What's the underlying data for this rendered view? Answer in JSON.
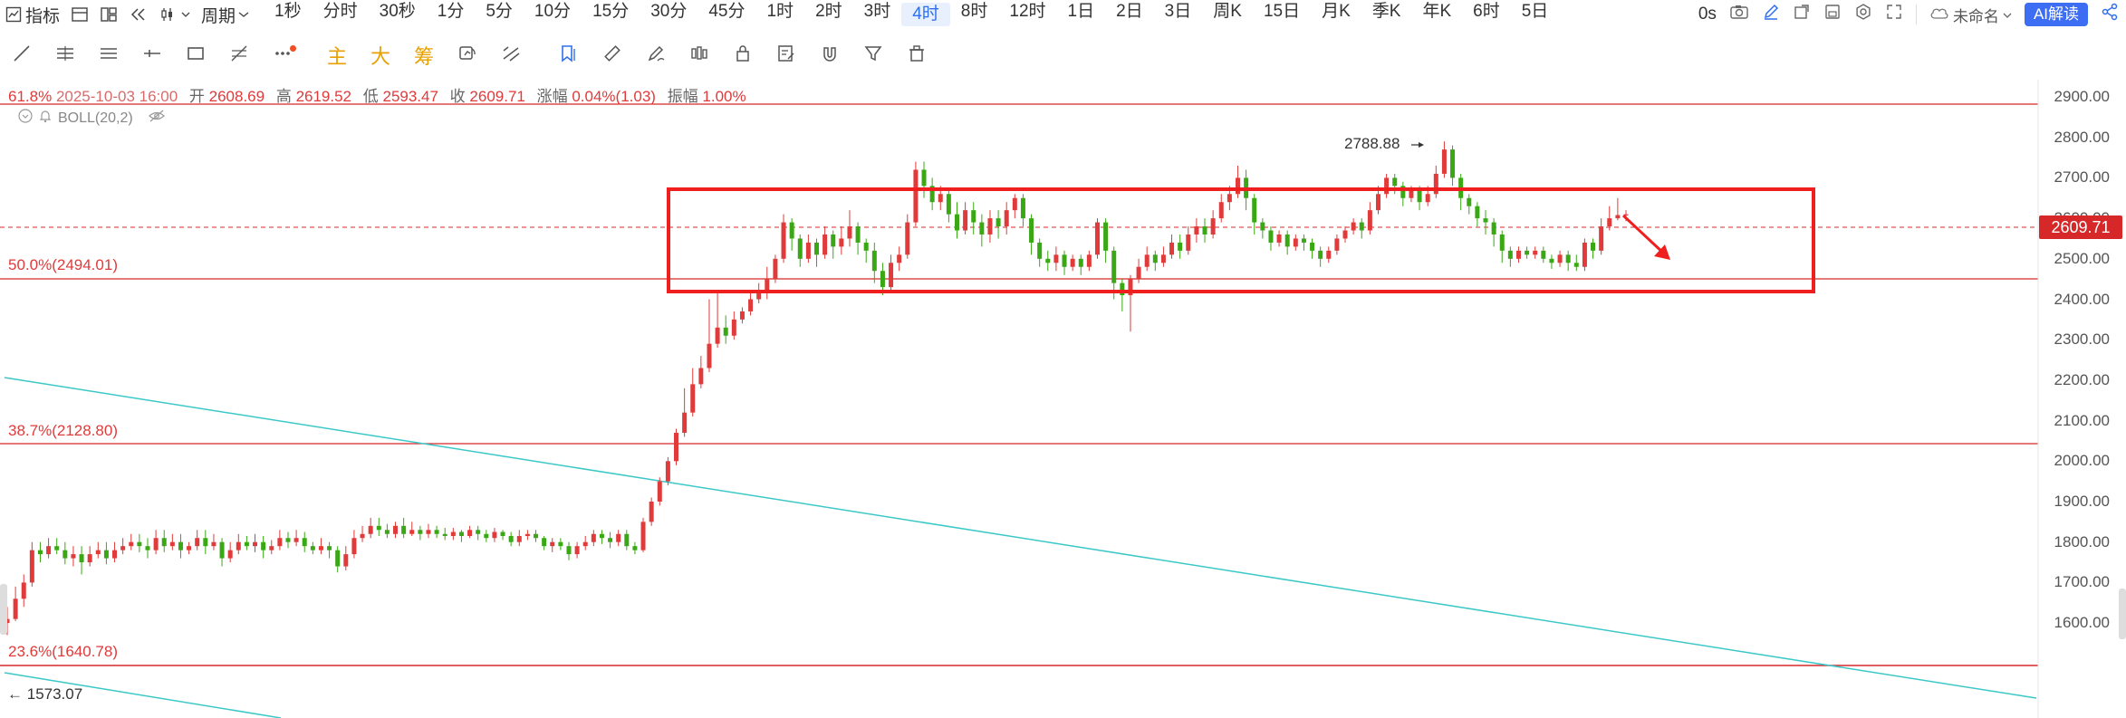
{
  "toolbar": {
    "indicator_label": "指标",
    "period_label": "周期",
    "timeframes": [
      "1秒",
      "分时",
      "30秒",
      "1分",
      "5分",
      "10分",
      "15分",
      "30分",
      "45分",
      "1时",
      "2时",
      "3时",
      "4时",
      "8时",
      "12时",
      "1日",
      "2日",
      "3日",
      "周K",
      "15日",
      "月K",
      "季K",
      "年K",
      "6时",
      "5日"
    ],
    "active_timeframe": "4时",
    "countdown": "0s",
    "unnamed_label": "未命名",
    "ai_button": "AI解读"
  },
  "drawing_toolbar": {
    "main_label": "主",
    "big_label": "大",
    "chip_label": "筹"
  },
  "ohlc_bar": {
    "fib_prefix": "61.8%",
    "date": "2025-10-03 16:00",
    "open_label": "开",
    "open": "2608.69",
    "high_label": "高",
    "high": "2619.52",
    "low_label": "低",
    "low": "2593.47",
    "close_label": "收",
    "close": "2609.71",
    "change_label": "涨幅",
    "change": "0.04%(1.03)",
    "amplitude_label": "振幅",
    "amplitude": "1.00%"
  },
  "indicator_row": {
    "boll_label": "BOLL(20,2)"
  },
  "fib_levels": [
    {
      "label": "50.0%(2494.01)",
      "price": 2494.01
    },
    {
      "label": "38.7%(2128.80)",
      "price": 2128.8
    },
    {
      "label": "23.6%(1640.78)",
      "price": 1640.78
    }
  ],
  "y_axis": [
    "2900.00",
    "2800.00",
    "2700.00",
    "2600.00",
    "2500.00",
    "2400.00",
    "2300.00",
    "2200.00",
    "2100.00",
    "2000.00",
    "1900.00",
    "1800.00",
    "1700.00",
    "1600.00"
  ],
  "current_price_tag": "2609.71",
  "annotations": {
    "high_marker": "2788.88",
    "low_marker": "1573.07"
  },
  "colors": {
    "up": "#e03a3a",
    "down": "#3aa815",
    "fib_line": "#d62828",
    "trend_line": "#3cc8c8",
    "accent": "#2f6fed",
    "box": "#f01f1f"
  },
  "chart_data": {
    "type": "candlestick",
    "ylim": [
      1560,
      2925
    ],
    "highest": 2788.88,
    "lowest": 1573.07,
    "last_close": 2609.71,
    "candles": [
      [
        1600,
        1610,
        1570,
        1640
      ],
      [
        1610,
        1660,
        1605,
        1690
      ],
      [
        1660,
        1700,
        1640,
        1720
      ],
      [
        1700,
        1780,
        1690,
        1800
      ],
      [
        1780,
        1770,
        1750,
        1800
      ],
      [
        1770,
        1790,
        1760,
        1810
      ],
      [
        1790,
        1780,
        1770,
        1810
      ],
      [
        1780,
        1760,
        1745,
        1800
      ],
      [
        1760,
        1770,
        1740,
        1790
      ],
      [
        1770,
        1750,
        1720,
        1790
      ],
      [
        1750,
        1770,
        1740,
        1790
      ],
      [
        1770,
        1780,
        1760,
        1800
      ],
      [
        1780,
        1760,
        1745,
        1800
      ],
      [
        1760,
        1780,
        1750,
        1800
      ],
      [
        1780,
        1790,
        1770,
        1810
      ],
      [
        1790,
        1800,
        1780,
        1820
      ],
      [
        1800,
        1790,
        1775,
        1820
      ],
      [
        1790,
        1780,
        1760,
        1810
      ],
      [
        1780,
        1810,
        1770,
        1830
      ],
      [
        1810,
        1790,
        1775,
        1830
      ],
      [
        1790,
        1800,
        1780,
        1820
      ],
      [
        1800,
        1780,
        1760,
        1820
      ],
      [
        1780,
        1790,
        1770,
        1800
      ],
      [
        1790,
        1810,
        1780,
        1830
      ],
      [
        1810,
        1790,
        1770,
        1830
      ],
      [
        1790,
        1800,
        1780,
        1820
      ],
      [
        1800,
        1760,
        1740,
        1810
      ],
      [
        1760,
        1780,
        1750,
        1800
      ],
      [
        1780,
        1800,
        1770,
        1820
      ],
      [
        1800,
        1790,
        1780,
        1815
      ],
      [
        1790,
        1800,
        1775,
        1820
      ],
      [
        1800,
        1780,
        1760,
        1815
      ],
      [
        1780,
        1790,
        1770,
        1805
      ],
      [
        1790,
        1810,
        1780,
        1830
      ],
      [
        1810,
        1800,
        1785,
        1825
      ],
      [
        1800,
        1810,
        1790,
        1830
      ],
      [
        1810,
        1790,
        1775,
        1825
      ],
      [
        1790,
        1780,
        1770,
        1800
      ],
      [
        1780,
        1790,
        1770,
        1810
      ],
      [
        1790,
        1780,
        1760,
        1800
      ],
      [
        1780,
        1740,
        1725,
        1790
      ],
      [
        1740,
        1770,
        1730,
        1790
      ],
      [
        1770,
        1810,
        1760,
        1830
      ],
      [
        1810,
        1820,
        1800,
        1840
      ],
      [
        1820,
        1840,
        1810,
        1860
      ],
      [
        1840,
        1830,
        1815,
        1860
      ],
      [
        1830,
        1820,
        1810,
        1845
      ],
      [
        1820,
        1840,
        1810,
        1850
      ],
      [
        1840,
        1820,
        1810,
        1860
      ],
      [
        1820,
        1830,
        1815,
        1850
      ],
      [
        1830,
        1820,
        1805,
        1840
      ],
      [
        1820,
        1830,
        1810,
        1845
      ],
      [
        1830,
        1820,
        1810,
        1840
      ],
      [
        1820,
        1815,
        1805,
        1835
      ],
      [
        1815,
        1825,
        1805,
        1835
      ],
      [
        1825,
        1815,
        1800,
        1830
      ],
      [
        1815,
        1830,
        1810,
        1840
      ],
      [
        1830,
        1820,
        1805,
        1840
      ],
      [
        1820,
        1810,
        1800,
        1830
      ],
      [
        1810,
        1825,
        1800,
        1835
      ],
      [
        1825,
        1815,
        1805,
        1830
      ],
      [
        1815,
        1800,
        1790,
        1825
      ],
      [
        1800,
        1815,
        1790,
        1830
      ],
      [
        1815,
        1820,
        1805,
        1830
      ],
      [
        1820,
        1810,
        1800,
        1830
      ],
      [
        1810,
        1790,
        1780,
        1815
      ],
      [
        1790,
        1800,
        1775,
        1810
      ],
      [
        1800,
        1790,
        1780,
        1810
      ],
      [
        1790,
        1770,
        1755,
        1800
      ],
      [
        1770,
        1790,
        1760,
        1800
      ],
      [
        1790,
        1800,
        1780,
        1815
      ],
      [
        1800,
        1820,
        1790,
        1830
      ],
      [
        1820,
        1810,
        1795,
        1830
      ],
      [
        1810,
        1800,
        1785,
        1825
      ],
      [
        1800,
        1820,
        1790,
        1830
      ],
      [
        1820,
        1790,
        1780,
        1830
      ],
      [
        1790,
        1780,
        1770,
        1800
      ],
      [
        1780,
        1850,
        1775,
        1860
      ],
      [
        1850,
        1900,
        1840,
        1910
      ],
      [
        1900,
        1950,
        1890,
        1960
      ],
      [
        1950,
        2000,
        1940,
        2010
      ],
      [
        2000,
        2070,
        1990,
        2080
      ],
      [
        2070,
        2120,
        2060,
        2180
      ],
      [
        2120,
        2190,
        2110,
        2230
      ],
      [
        2190,
        2230,
        2180,
        2260
      ],
      [
        2230,
        2290,
        2220,
        2400
      ],
      [
        2290,
        2330,
        2280,
        2420
      ],
      [
        2330,
        2310,
        2290,
        2360
      ],
      [
        2310,
        2350,
        2300,
        2370
      ],
      [
        2350,
        2370,
        2340,
        2380
      ],
      [
        2370,
        2400,
        2360,
        2420
      ],
      [
        2400,
        2420,
        2390,
        2440
      ],
      [
        2420,
        2450,
        2400,
        2480
      ],
      [
        2450,
        2500,
        2440,
        2510
      ],
      [
        2500,
        2590,
        2490,
        2610
      ],
      [
        2590,
        2550,
        2520,
        2600
      ],
      [
        2550,
        2500,
        2480,
        2560
      ],
      [
        2500,
        2540,
        2490,
        2560
      ],
      [
        2540,
        2510,
        2480,
        2550
      ],
      [
        2510,
        2560,
        2500,
        2580
      ],
      [
        2560,
        2530,
        2500,
        2570
      ],
      [
        2530,
        2550,
        2510,
        2580
      ],
      [
        2550,
        2580,
        2530,
        2620
      ],
      [
        2580,
        2540,
        2510,
        2590
      ],
      [
        2540,
        2520,
        2490,
        2550
      ],
      [
        2520,
        2470,
        2440,
        2540
      ],
      [
        2470,
        2430,
        2410,
        2490
      ],
      [
        2430,
        2490,
        2420,
        2510
      ],
      [
        2490,
        2510,
        2470,
        2530
      ],
      [
        2510,
        2590,
        2500,
        2610
      ],
      [
        2590,
        2720,
        2580,
        2740
      ],
      [
        2720,
        2680,
        2650,
        2740
      ],
      [
        2680,
        2640,
        2620,
        2700
      ],
      [
        2640,
        2660,
        2620,
        2680
      ],
      [
        2660,
        2610,
        2590,
        2670
      ],
      [
        2610,
        2570,
        2550,
        2640
      ],
      [
        2570,
        2620,
        2560,
        2640
      ],
      [
        2620,
        2590,
        2560,
        2640
      ],
      [
        2590,
        2560,
        2530,
        2610
      ],
      [
        2560,
        2600,
        2540,
        2620
      ],
      [
        2600,
        2580,
        2550,
        2620
      ],
      [
        2580,
        2620,
        2560,
        2640
      ],
      [
        2620,
        2650,
        2600,
        2660
      ],
      [
        2650,
        2600,
        2580,
        2660
      ],
      [
        2600,
        2540,
        2510,
        2610
      ],
      [
        2540,
        2500,
        2480,
        2550
      ],
      [
        2500,
        2490,
        2470,
        2520
      ],
      [
        2490,
        2510,
        2470,
        2530
      ],
      [
        2510,
        2480,
        2460,
        2520
      ],
      [
        2480,
        2500,
        2470,
        2510
      ],
      [
        2500,
        2480,
        2460,
        2510
      ],
      [
        2480,
        2510,
        2470,
        2520
      ],
      [
        2510,
        2590,
        2500,
        2600
      ],
      [
        2590,
        2520,
        2490,
        2600
      ],
      [
        2520,
        2440,
        2400,
        2530
      ],
      [
        2440,
        2410,
        2370,
        2450
      ],
      [
        2410,
        2450,
        2320,
        2460
      ],
      [
        2450,
        2480,
        2440,
        2500
      ],
      [
        2480,
        2510,
        2470,
        2530
      ],
      [
        2510,
        2490,
        2470,
        2520
      ],
      [
        2490,
        2510,
        2480,
        2530
      ],
      [
        2510,
        2540,
        2500,
        2560
      ],
      [
        2540,
        2520,
        2500,
        2560
      ],
      [
        2520,
        2560,
        2510,
        2580
      ],
      [
        2560,
        2580,
        2540,
        2600
      ],
      [
        2580,
        2560,
        2540,
        2600
      ],
      [
        2560,
        2600,
        2550,
        2620
      ],
      [
        2600,
        2640,
        2590,
        2660
      ],
      [
        2640,
        2660,
        2620,
        2680
      ],
      [
        2660,
        2700,
        2650,
        2730
      ],
      [
        2700,
        2650,
        2620,
        2720
      ],
      [
        2650,
        2590,
        2560,
        2660
      ],
      [
        2590,
        2570,
        2550,
        2600
      ],
      [
        2570,
        2540,
        2520,
        2580
      ],
      [
        2540,
        2560,
        2530,
        2570
      ],
      [
        2560,
        2530,
        2510,
        2570
      ],
      [
        2530,
        2550,
        2520,
        2560
      ],
      [
        2550,
        2540,
        2520,
        2560
      ],
      [
        2540,
        2520,
        2500,
        2550
      ],
      [
        2520,
        2500,
        2480,
        2530
      ],
      [
        2500,
        2520,
        2490,
        2530
      ],
      [
        2520,
        2550,
        2510,
        2560
      ],
      [
        2550,
        2570,
        2540,
        2580
      ],
      [
        2570,
        2590,
        2560,
        2600
      ],
      [
        2590,
        2570,
        2550,
        2600
      ],
      [
        2570,
        2620,
        2560,
        2640
      ],
      [
        2620,
        2660,
        2610,
        2680
      ],
      [
        2660,
        2700,
        2650,
        2710
      ],
      [
        2700,
        2680,
        2660,
        2710
      ],
      [
        2680,
        2650,
        2630,
        2690
      ],
      [
        2650,
        2670,
        2640,
        2680
      ],
      [
        2670,
        2640,
        2620,
        2680
      ],
      [
        2640,
        2660,
        2630,
        2680
      ],
      [
        2660,
        2710,
        2650,
        2730
      ],
      [
        2710,
        2770,
        2700,
        2790
      ],
      [
        2770,
        2700,
        2680,
        2780
      ],
      [
        2700,
        2650,
        2620,
        2710
      ],
      [
        2650,
        2630,
        2610,
        2660
      ],
      [
        2630,
        2600,
        2580,
        2640
      ],
      [
        2600,
        2590,
        2560,
        2620
      ],
      [
        2590,
        2560,
        2530,
        2600
      ],
      [
        2560,
        2520,
        2490,
        2570
      ],
      [
        2520,
        2500,
        2480,
        2530
      ],
      [
        2500,
        2520,
        2490,
        2530
      ],
      [
        2520,
        2510,
        2500,
        2530
      ],
      [
        2510,
        2520,
        2500,
        2530
      ],
      [
        2520,
        2500,
        2490,
        2530
      ],
      [
        2500,
        2490,
        2475,
        2510
      ],
      [
        2490,
        2510,
        2480,
        2520
      ],
      [
        2510,
        2490,
        2470,
        2520
      ],
      [
        2490,
        2480,
        2470,
        2510
      ],
      [
        2480,
        2540,
        2470,
        2550
      ],
      [
        2540,
        2520,
        2500,
        2550
      ],
      [
        2520,
        2580,
        2510,
        2600
      ],
      [
        2580,
        2600,
        2570,
        2630
      ],
      [
        2600,
        2608,
        2595,
        2650
      ],
      [
        2608,
        2610,
        2593,
        2620
      ]
    ]
  }
}
